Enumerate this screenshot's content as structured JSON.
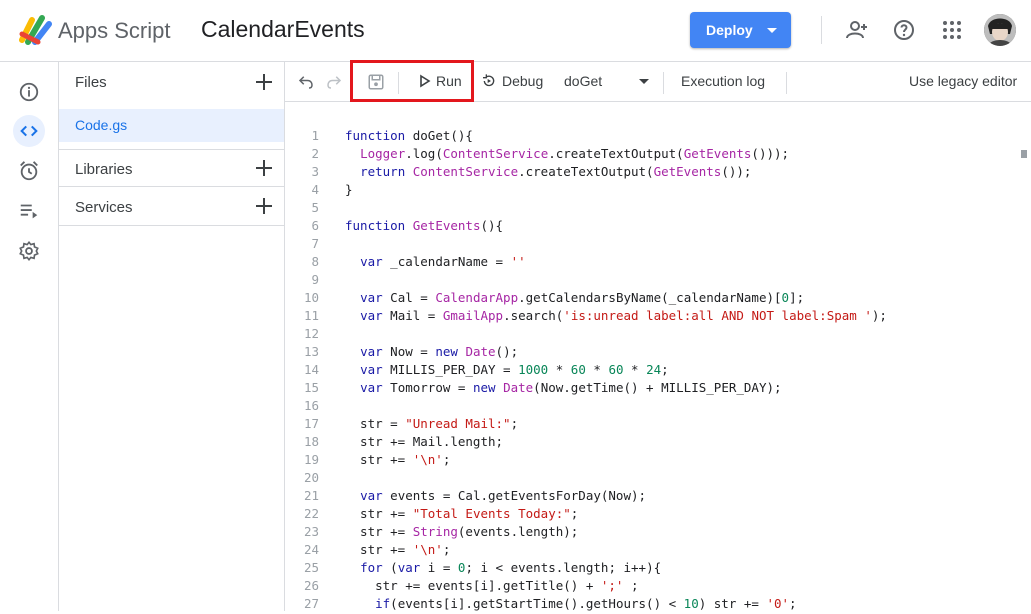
{
  "header": {
    "app_name": "Apps Script",
    "project_name": "CalendarEvents",
    "deploy_label": "Deploy",
    "icons": [
      "apps-script-logo",
      "add-person-icon",
      "help-icon",
      "apps-grid-icon",
      "account-avatar"
    ]
  },
  "rail": {
    "items": [
      "overview-icon",
      "editor-icon",
      "triggers-icon",
      "executions-icon",
      "settings-icon"
    ],
    "active": "editor-icon"
  },
  "files_panel": {
    "files_label": "Files",
    "files": [
      {
        "name": "Code.gs",
        "selected": true
      }
    ],
    "libraries_label": "Libraries",
    "services_label": "Services"
  },
  "toolbar": {
    "run_label": "Run",
    "debug_label": "Debug",
    "function_select": "doGet",
    "execution_log_label": "Execution log",
    "legacy_label": "Use legacy editor"
  },
  "code_lines": [
    {
      "n": "1",
      "text": "function doGet(){"
    },
    {
      "n": "2",
      "text": "  Logger.log(ContentService.createTextOutput(GetEvents()));"
    },
    {
      "n": "3",
      "text": "  return ContentService.createTextOutput(GetEvents());"
    },
    {
      "n": "4",
      "text": "}"
    },
    {
      "n": "5",
      "text": ""
    },
    {
      "n": "6",
      "text": "function GetEvents(){"
    },
    {
      "n": "7",
      "text": ""
    },
    {
      "n": "8",
      "text": "  var _calendarName = ''"
    },
    {
      "n": "9",
      "text": ""
    },
    {
      "n": "10",
      "text": "  var Cal = CalendarApp.getCalendarsByName(_calendarName)[0];"
    },
    {
      "n": "11",
      "text": "  var Mail = GmailApp.search('is:unread label:all AND NOT label:Spam ');"
    },
    {
      "n": "12",
      "text": ""
    },
    {
      "n": "13",
      "text": "  var Now = new Date();"
    },
    {
      "n": "14",
      "text": "  var MILLIS_PER_DAY = 1000 * 60 * 60 * 24;"
    },
    {
      "n": "15",
      "text": "  var Tomorrow = new Date(Now.getTime() + MILLIS_PER_DAY);"
    },
    {
      "n": "16",
      "text": ""
    },
    {
      "n": "17",
      "text": "  str = \"Unread Mail:\";"
    },
    {
      "n": "18",
      "text": "  str += Mail.length;"
    },
    {
      "n": "19",
      "text": "  str += '\\n';"
    },
    {
      "n": "20",
      "text": ""
    },
    {
      "n": "21",
      "text": "  var events = Cal.getEventsForDay(Now);"
    },
    {
      "n": "22",
      "text": "  str += \"Total Events Today:\";"
    },
    {
      "n": "23",
      "text": "  str += String(events.length);"
    },
    {
      "n": "24",
      "text": "  str += '\\n';"
    },
    {
      "n": "25",
      "text": "  for (var i = 0; i < events.length; i++){"
    },
    {
      "n": "26",
      "text": "    str += events[i].getTitle() + ';' ;"
    },
    {
      "n": "27",
      "text": "    if(events[i].getStartTime().getHours() < 10) str += '0';"
    }
  ],
  "colors": {
    "accent": "#4285f4",
    "highlight_box": "#e3171d",
    "selected_bg": "#e8f0fe"
  }
}
